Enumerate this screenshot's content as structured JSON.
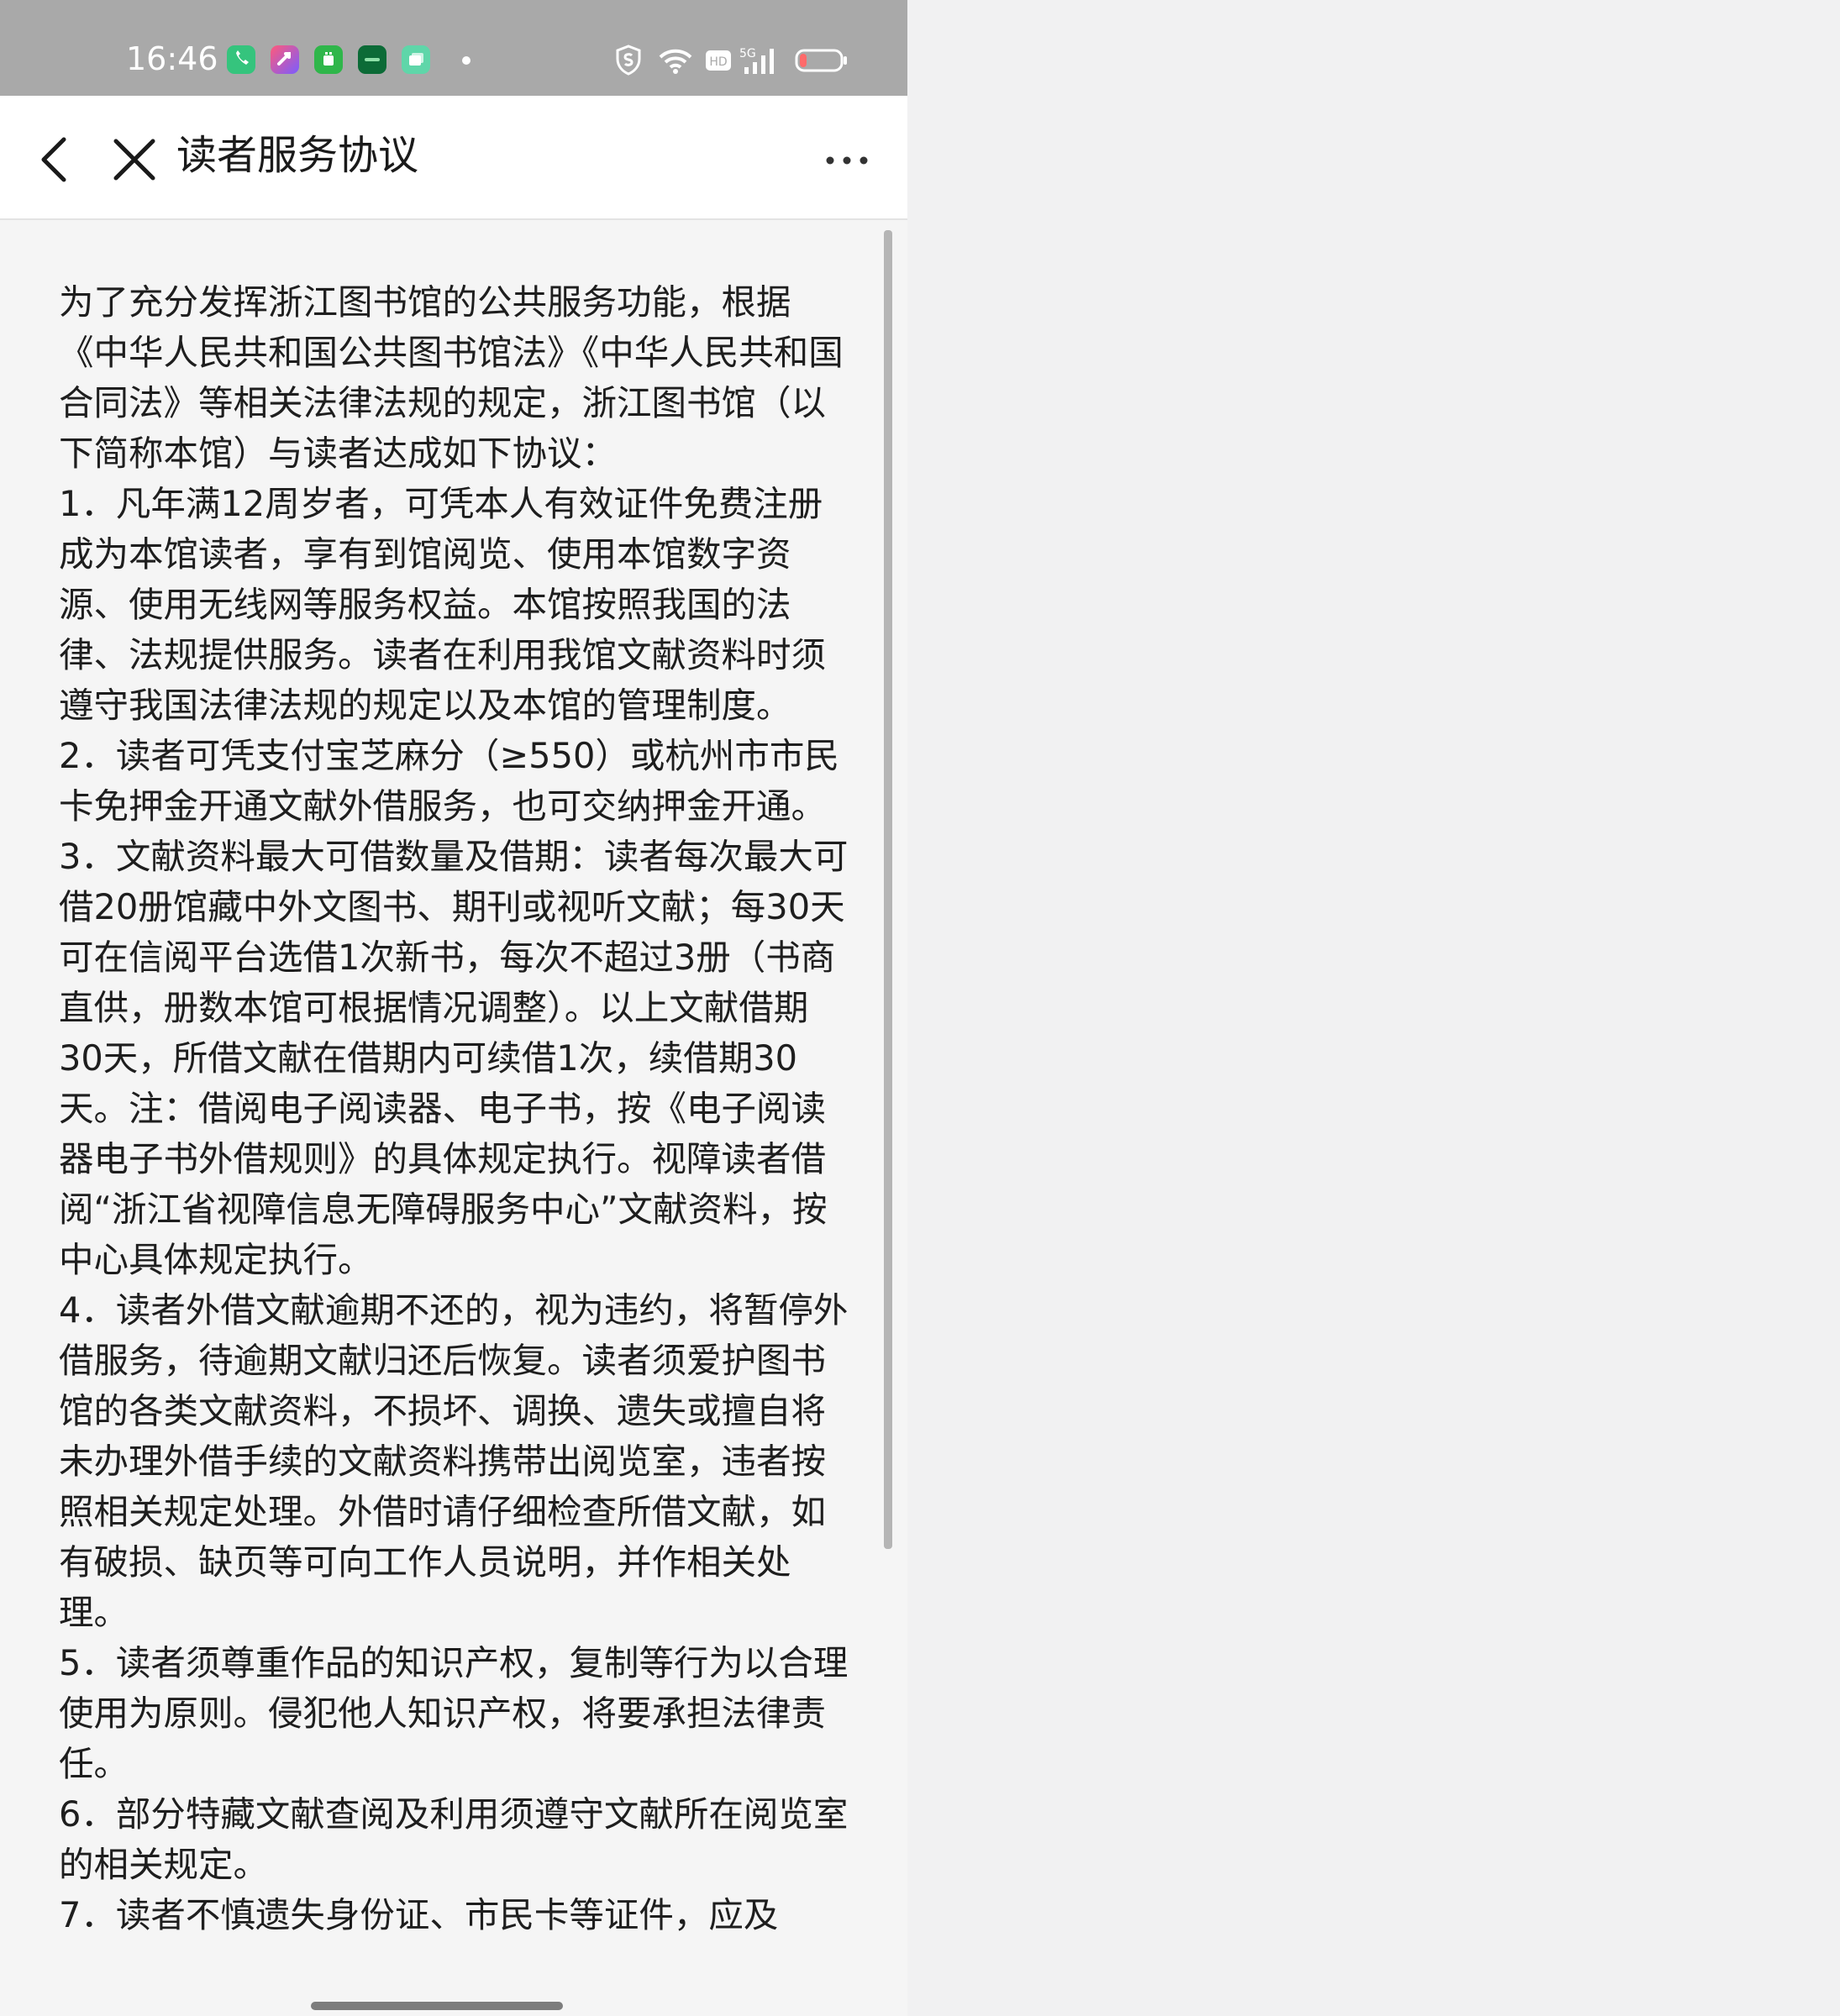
{
  "status_bar": {
    "time": "16:46",
    "app_icons": [
      "phone-app-icon",
      "shortcut-app-icon",
      "android-app-icon",
      "oppo-app-icon",
      "files-app-icon"
    ],
    "system_icons": [
      "shield-icon",
      "wifi-icon",
      "hd-icon",
      "5g-signal-icon",
      "battery-low-icon"
    ],
    "network_label": "5G",
    "hd_label": "HD",
    "colors": {
      "background": "#a9a9a9",
      "battery_level": "#ff6a6a"
    }
  },
  "nav": {
    "title": "读者服务协议",
    "back_icon": "chevron-left-icon",
    "close_icon": "close-icon",
    "more_icon": "more-dots-icon"
  },
  "document": {
    "paragraphs": [
      "为了充分发挥浙江图书馆的公共服务功能，根据《中华人民共和国公共图书馆法》《中华人民共和国合同法》等相关法律法规的规定，浙江图书馆（以下简称本馆）与读者达成如下协议：",
      "1．凡年满12周岁者，可凭本人有效证件免费注册成为本馆读者，享有到馆阅览、使用本馆数字资源、使用无线网等服务权益。本馆按照我国的法律、法规提供服务。读者在利用我馆文献资料时须遵守我国法律法规的规定以及本馆的管理制度。",
      "2．读者可凭支付宝芝麻分（≥550）或杭州市市民卡免押金开通文献外借服务，也可交纳押金开通。",
      "3．文献资料最大可借数量及借期：读者每次最大可借20册馆藏中外文图书、期刊或视听文献；每30天可在信阅平台选借1次新书，每次不超过3册（书商直供，册数本馆可根据情况调整）。以上文献借期30天，所借文献在借期内可续借1次，续借期30天。注：借阅电子阅读器、电子书，按《电子阅读器电子书外借规则》的具体规定执行。视障读者借阅“浙江省视障信息无障碍服务中心”文献资料，按中心具体规定执行。",
      "4．读者外借文献逾期不还的，视为违约，将暂停外借服务，待逾期文献归还后恢复。读者须爱护图书馆的各类文献资料，不损坏、调换、遗失或擅自将未办理外借手续的文献资料携带出阅览室，违者按照相关规定处理。外借时请仔细检查所借文献，如有破损、缺页等可向工作人员说明，并作相关处理。",
      "5．读者须尊重作品的知识产权，复制等行为以合理使用为原则。侵犯他人知识产权，将要承担法律责任。",
      "6．部分特藏文献查阅及利用须遵守文献所在阅览室的相关规定。",
      "7．读者不慎遗失身份证、市民卡等证件，应及"
    ]
  }
}
